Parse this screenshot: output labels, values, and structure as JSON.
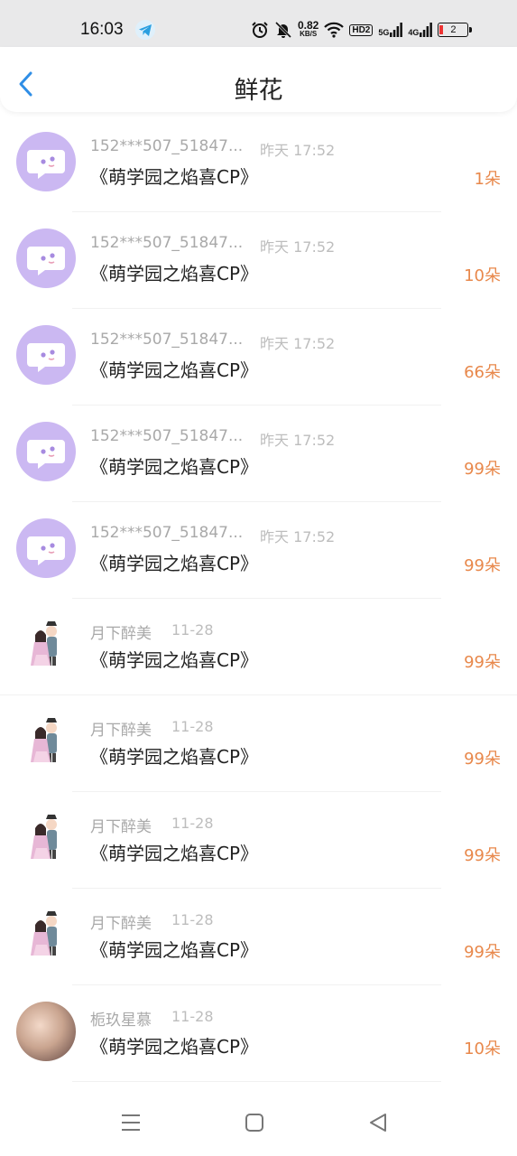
{
  "status_bar": {
    "time": "16:03",
    "speed_value": "0.82",
    "speed_unit": "KB/S",
    "hd_label": "HD2",
    "net_5g": "5G",
    "net_4g": "4G",
    "battery_level": "2",
    "icons": [
      "telegram-icon",
      "alarm-icon",
      "mute-icon",
      "wifi-icon",
      "signal-icon",
      "battery-icon"
    ]
  },
  "header": {
    "title": "鲜花",
    "back_icon": "back-chevron-icon",
    "accent": "#2f8ee6"
  },
  "list": {
    "count_color": "#e8884b",
    "items": [
      {
        "avatar": "chat-bubble-avatar",
        "name": "152***507_51847...",
        "time": "昨天 17:52",
        "book": "《萌学园之焰喜CP》",
        "count": "1朵"
      },
      {
        "avatar": "chat-bubble-avatar",
        "name": "152***507_51847...",
        "time": "昨天 17:52",
        "book": "《萌学园之焰喜CP》",
        "count": "10朵"
      },
      {
        "avatar": "chat-bubble-avatar",
        "name": "152***507_51847...",
        "time": "昨天 17:52",
        "book": "《萌学园之焰喜CP》",
        "count": "66朵"
      },
      {
        "avatar": "chat-bubble-avatar",
        "name": "152***507_51847...",
        "time": "昨天 17:52",
        "book": "《萌学园之焰喜CP》",
        "count": "99朵"
      },
      {
        "avatar": "chat-bubble-avatar",
        "name": "152***507_51847...",
        "time": "昨天 17:52",
        "book": "《萌学园之焰喜CP》",
        "count": "99朵"
      },
      {
        "avatar": "couple-cartoon-avatar",
        "name": "月下醉美",
        "time": "11-28",
        "book": "《萌学园之焰喜CP》",
        "count": "99朵"
      },
      {
        "avatar": "couple-cartoon-avatar",
        "name": "月下醉美",
        "time": "11-28",
        "book": "《萌学园之焰喜CP》",
        "count": "99朵"
      },
      {
        "avatar": "couple-cartoon-avatar",
        "name": "月下醉美",
        "time": "11-28",
        "book": "《萌学园之焰喜CP》",
        "count": "99朵"
      },
      {
        "avatar": "couple-cartoon-avatar",
        "name": "月下醉美",
        "time": "11-28",
        "book": "《萌学园之焰喜CP》",
        "count": "99朵"
      },
      {
        "avatar": "user-photo-avatar",
        "name": "栀玖星慕",
        "time": "11-28",
        "book": "《萌学园之焰喜CP》",
        "count": "10朵"
      }
    ]
  },
  "nav_bar": {
    "icons": [
      "menu-icon",
      "home-square-icon",
      "back-triangle-icon"
    ]
  }
}
